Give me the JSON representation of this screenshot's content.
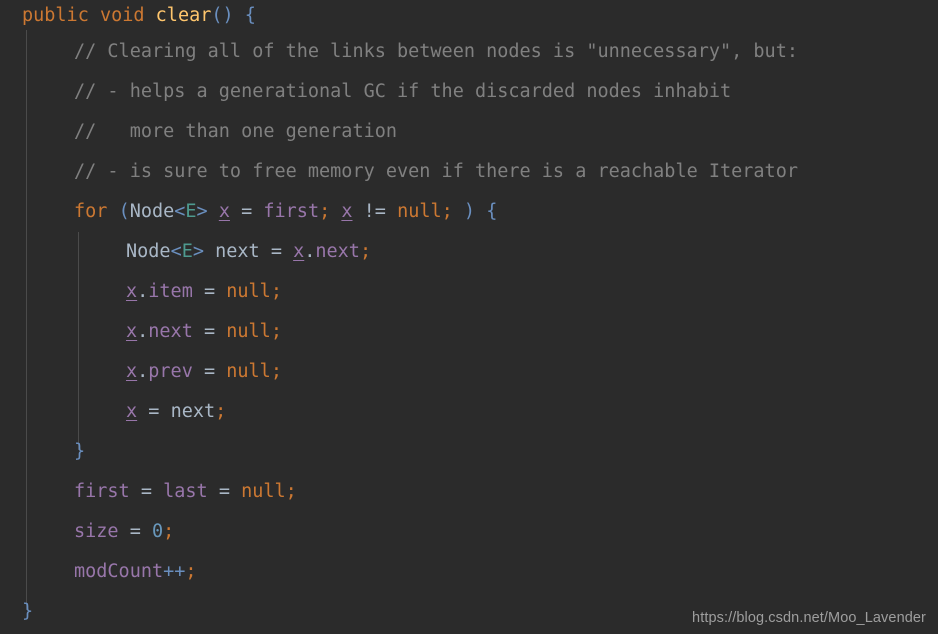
{
  "editor": {
    "language": "java",
    "theme": "darcula",
    "background_color": "#2b2b2b",
    "default_text_color": "#a9b7c6",
    "indent_guide_color": "#4b4b4b",
    "colors": {
      "keyword": "#cc7832",
      "method_declaration": "#ffc66d",
      "comment": "#808080",
      "field": "#9876aa",
      "local_variable": "#9876aa",
      "type": "#a9b7c6",
      "type_parameter": "#4e9a8f",
      "number": "#6897bb",
      "bracket": "#6a8fbf",
      "semicolon": "#cc7832"
    }
  },
  "code": {
    "lines": [
      {
        "n": 1,
        "indent": 0,
        "text": "public void clear() {"
      },
      {
        "n": 2,
        "indent": 1,
        "text": "// Clearing all of the links between nodes is \"unnecessary\", but:"
      },
      {
        "n": 3,
        "indent": 1,
        "text": "// - helps a generational GC if the discarded nodes inhabit"
      },
      {
        "n": 4,
        "indent": 1,
        "text": "//   more than one generation"
      },
      {
        "n": 5,
        "indent": 1,
        "text": "// - is sure to free memory even if there is a reachable Iterator"
      },
      {
        "n": 6,
        "indent": 1,
        "text": "for (Node<E> x = first; x != null; ) {"
      },
      {
        "n": 7,
        "indent": 2,
        "text": "Node<E> next = x.next;"
      },
      {
        "n": 8,
        "indent": 2,
        "text": "x.item = null;"
      },
      {
        "n": 9,
        "indent": 2,
        "text": "x.next = null;"
      },
      {
        "n": 10,
        "indent": 2,
        "text": "x.prev = null;"
      },
      {
        "n": 11,
        "indent": 2,
        "text": "x = next;"
      },
      {
        "n": 12,
        "indent": 1,
        "text": "}"
      },
      {
        "n": 13,
        "indent": 1,
        "text": "first = last = null;"
      },
      {
        "n": 14,
        "indent": 1,
        "text": "size = 0;"
      },
      {
        "n": 15,
        "indent": 1,
        "text": "modCount++;"
      },
      {
        "n": 16,
        "indent": 0,
        "text": "}"
      }
    ],
    "tokens": {
      "kw_public": "public",
      "kw_void": "void",
      "kw_for": "for",
      "method_clear": "clear",
      "type_node": "Node",
      "type_param_e": "E",
      "var_x": "x",
      "var_next": "next",
      "field_first": "first",
      "field_last": "last",
      "field_size": "size",
      "field_modcount": "modCount",
      "field_item": "item",
      "field_next": "next",
      "field_prev": "prev",
      "lit_null": "null",
      "num_zero": "0",
      "op_neq": "!=",
      "op_assign": "=",
      "op_incr": "++",
      "semi": ";",
      "paren_open": "(",
      "paren_close": ")",
      "angle_open": "<",
      "angle_close": ">",
      "brace_open": "{",
      "brace_close": "}",
      "dot": ".",
      "space": " ",
      "comment_1": "// Clearing all of the links between nodes is \"unnecessary\", but:",
      "comment_2": "// - helps a generational GC if the discarded nodes inhabit",
      "comment_3": "//   more than one generation",
      "comment_4": "// - is sure to free memory even if there is a reachable Iterator"
    }
  },
  "watermark": {
    "text": "https://blog.csdn.net/Moo_Lavender"
  }
}
